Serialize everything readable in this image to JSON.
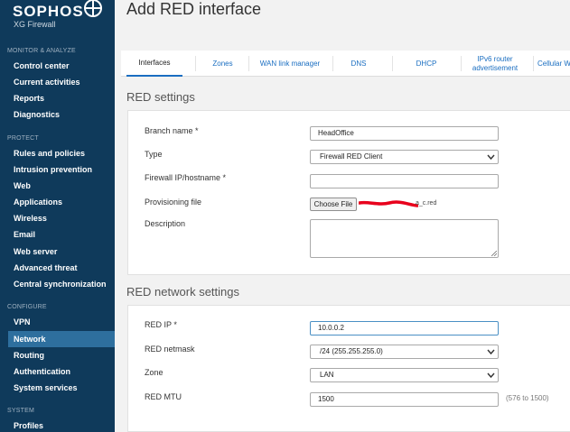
{
  "brand": {
    "name": "SOPHOS",
    "product": "XG Firewall"
  },
  "sidebar": {
    "sections": [
      {
        "label": "MONITOR & ANALYZE",
        "items": [
          "Control center",
          "Current activities",
          "Reports",
          "Diagnostics"
        ]
      },
      {
        "label": "PROTECT",
        "items": [
          "Rules and policies",
          "Intrusion prevention",
          "Web",
          "Applications",
          "Wireless",
          "Email",
          "Web server",
          "Advanced threat",
          "Central synchronization"
        ]
      },
      {
        "label": "CONFIGURE",
        "items": [
          "VPN",
          "Network",
          "Routing",
          "Authentication",
          "System services"
        ]
      },
      {
        "label": "SYSTEM",
        "items": [
          "Profiles"
        ]
      }
    ],
    "active_item": "Network"
  },
  "page": {
    "title": "Add RED interface"
  },
  "tabs": [
    "Interfaces",
    "Zones",
    "WAN link manager",
    "DNS",
    "DHCP",
    "IPv6 router advertisement",
    "Cellular W"
  ],
  "red_settings": {
    "title": "RED settings",
    "branch_name": {
      "label": "Branch name *",
      "value": "HeadOffice"
    },
    "type": {
      "label": "Type",
      "value": "Firewall RED Client"
    },
    "firewall_ip": {
      "label": "Firewall IP/hostname *",
      "value": ""
    },
    "provisioning_file": {
      "label": "Provisioning file",
      "button": "Choose File",
      "filename_suffix": "a_c.red"
    },
    "description": {
      "label": "Description",
      "value": ""
    }
  },
  "red_network": {
    "title": "RED network settings",
    "ip": {
      "label": "RED IP *",
      "value": "10.0.0.2"
    },
    "netmask": {
      "label": "RED netmask",
      "value": "/24 (255.255.255.0)"
    },
    "zone": {
      "label": "Zone",
      "value": "LAN"
    },
    "mtu": {
      "label": "RED MTU",
      "value": "1500",
      "hint": "(576 to 1500)"
    }
  },
  "colors": {
    "sidebar_bg": "#0f3a5b",
    "active_nav": "#2e6f9e",
    "link": "#1a6ec1",
    "redaction": "#e8001c"
  }
}
